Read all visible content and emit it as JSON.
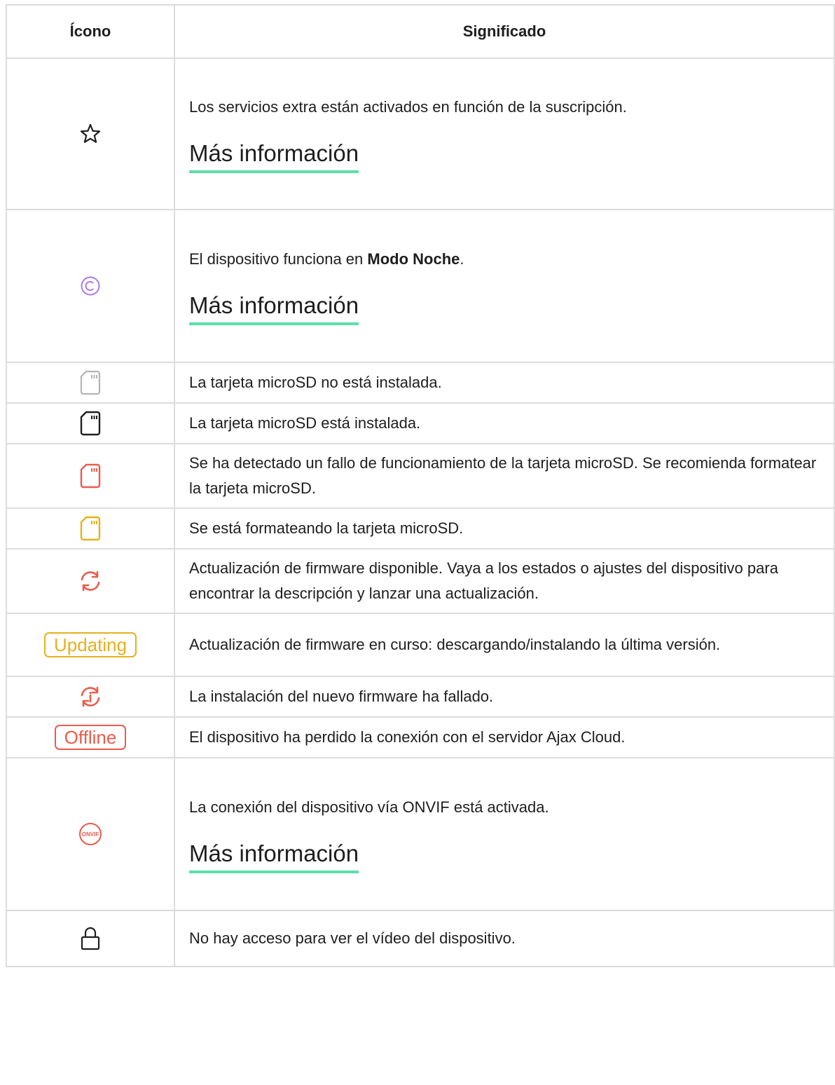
{
  "header": {
    "col_icon": "Ícono",
    "col_meaning": "Significado"
  },
  "rows": [
    {
      "icon": "star-outline-icon",
      "text": "Los servicios extra están activados en función de la suscripción.",
      "link": "Más información"
    },
    {
      "icon": "night-mode-icon",
      "text_before": "El dispositivo funciona en ",
      "text_bold": "Modo Noche",
      "text_after": ".",
      "link": "Más información"
    },
    {
      "icon": "microsd-not-installed-icon",
      "text": "La tarjeta microSD no está instalada."
    },
    {
      "icon": "microsd-installed-icon",
      "text": "La tarjeta microSD está instalada."
    },
    {
      "icon": "microsd-error-icon",
      "text": "Se ha detectado un fallo de funcionamiento de la tarjeta microSD. Se recomienda formatear la tarjeta microSD."
    },
    {
      "icon": "microsd-formatting-icon",
      "text": "Se está formateando la tarjeta microSD."
    },
    {
      "icon": "firmware-update-available-icon",
      "text": "Actualización de firmware disponible. Vaya a los estados o ajustes del dispositivo para encontrar la descripción y lanzar una actualización."
    },
    {
      "badge": "Updating",
      "text": "Actualización de firmware en curso: descargando/instalando la última versión."
    },
    {
      "icon": "firmware-update-failed-icon",
      "text": "La instalación del nuevo firmware ha fallado."
    },
    {
      "badge": "Offline",
      "text": "El dispositivo ha perdido la conexión con el servidor Ajax Cloud."
    },
    {
      "icon": "onvif-icon",
      "icon_text": "ONVIF",
      "text": "La conexión del dispositivo vía ONVIF está activada.",
      "link": "Más información"
    },
    {
      "icon": "lock-icon",
      "text": "No hay acceso para ver el vídeo del dispositivo."
    }
  ],
  "colors": {
    "link_underline": "#5adfa8",
    "night_mode": "#a97ae8",
    "error": "#ea5b4c",
    "warning": "#e6b11c",
    "muted": "#b4b4b4",
    "border": "#dcdcdc"
  }
}
